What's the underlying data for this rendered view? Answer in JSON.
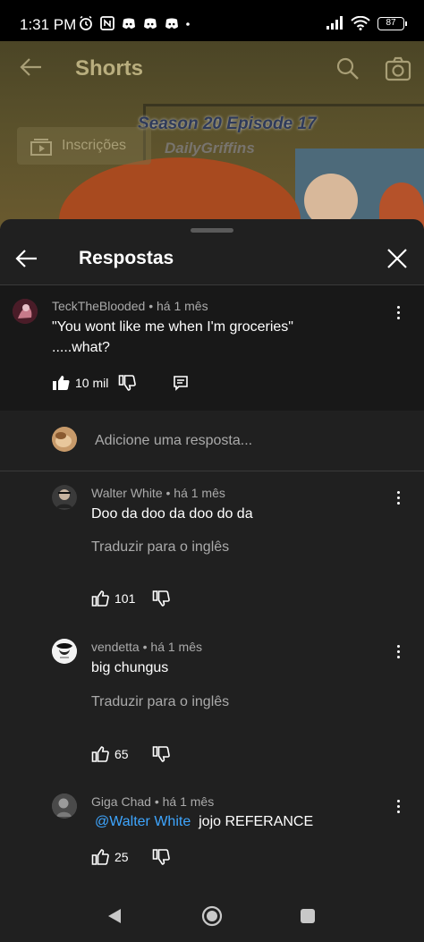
{
  "status_bar": {
    "time": "1:31 PM",
    "battery": "87"
  },
  "background": {
    "header_title": "Shorts",
    "subscriptions_label": "Inscrições",
    "video_overlay_text": "Season 20 Episode 17",
    "watermark_text": "DailyGriffins"
  },
  "sheet": {
    "title": "Respostas"
  },
  "parent_comment": {
    "author": "TeckTheBlooded",
    "time": "há 1 mês",
    "text_line1": "\"You wont like me when I'm groceries\"",
    "text_line2": ".....what?",
    "likes": "10 mil"
  },
  "add_reply": {
    "placeholder": "Adicione uma resposta..."
  },
  "replies": [
    {
      "author": "Walter White",
      "time": "há 1 mês",
      "text": "Doo da doo da doo do da",
      "translate_label": "Traduzir para o inglês",
      "likes": "101"
    },
    {
      "author": "vendetta",
      "time": "há 1 mês",
      "text": "big chungus",
      "translate_label": "Traduzir para o inglês",
      "likes": "65"
    },
    {
      "author": "Giga Chad",
      "time": "há 1 mês",
      "mention": "@Walter White",
      "text": "jojo REFERANCE",
      "likes": "25"
    }
  ],
  "meta_separator": "•",
  "colors": {
    "sheet_bg": "#202020",
    "parent_bg": "#181818",
    "mention": "#3ea6ff",
    "secondary_text": "#aaaaaa"
  }
}
